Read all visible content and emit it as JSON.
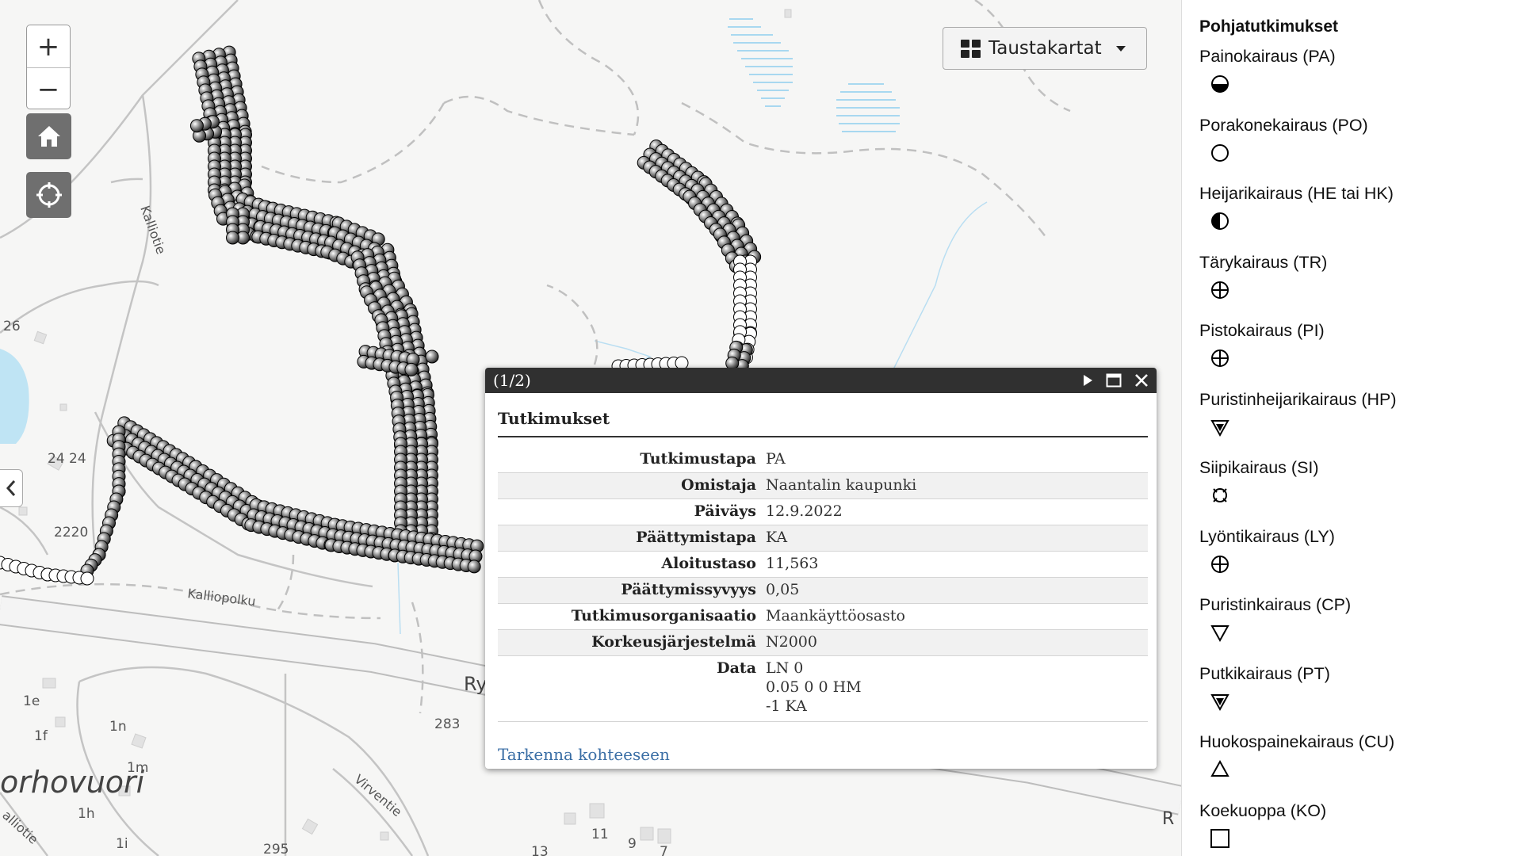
{
  "map": {
    "labels": [
      {
        "id": "kalliotie",
        "text": "Kalliotie"
      },
      {
        "id": "kalliopolku",
        "text": "Kalliopolku"
      },
      {
        "id": "virventie",
        "text": "Virventie"
      },
      {
        "id": "alliotie",
        "text": "alliotie"
      },
      {
        "id": "orhovuori",
        "text": "orhovuori"
      },
      {
        "id": "ry",
        "text": "Ry"
      },
      {
        "id": "r",
        "text": "R"
      },
      {
        "id": "n26",
        "text": "26"
      },
      {
        "id": "n2424",
        "text": "24 24"
      },
      {
        "id": "n2220",
        "text": "2220"
      },
      {
        "id": "n283",
        "text": "283"
      },
      {
        "id": "n295",
        "text": "295"
      },
      {
        "id": "n1e",
        "text": "1e"
      },
      {
        "id": "n1f",
        "text": "1f"
      },
      {
        "id": "n1n",
        "text": "1n"
      },
      {
        "id": "n1m",
        "text": "1m"
      },
      {
        "id": "n1h",
        "text": "1h"
      },
      {
        "id": "n1i",
        "text": "1i"
      },
      {
        "id": "n11",
        "text": "11"
      },
      {
        "id": "n9",
        "text": "9"
      },
      {
        "id": "n7",
        "text": "7"
      },
      {
        "id": "n13",
        "text": "13"
      }
    ]
  },
  "controls": {
    "zoom_in": "+",
    "zoom_out": "−",
    "basemaps_label": "Taustakartat"
  },
  "popup": {
    "counter": "(1/2)",
    "title": "Tutkimukset",
    "rows": [
      {
        "key": "Tutkimustapa",
        "value": "PA"
      },
      {
        "key": "Omistaja",
        "value": "Naantalin kaupunki"
      },
      {
        "key": "Päiväys",
        "value": "12.9.2022"
      },
      {
        "key": "Päättymistapa",
        "value": "KA"
      },
      {
        "key": "Aloitustaso",
        "value": "11,563"
      },
      {
        "key": "Päättymissyvyys",
        "value": "0,05"
      },
      {
        "key": "Tutkimusorganisaatio",
        "value": "Maankäyttöosasto"
      },
      {
        "key": "Korkeusjärjestelmä",
        "value": "N2000"
      },
      {
        "key": "Data",
        "value": "LN 0\n0.05 0 0 HM\n-1 KA"
      }
    ],
    "link": "Tarkenna kohteeseen"
  },
  "legend": {
    "title": "Pohjatutkimukset",
    "items": [
      {
        "label": "Painokairaus (PA)",
        "symbol": "half-filled-circle"
      },
      {
        "label": "Porakonekairaus (PO)",
        "symbol": "open-circle"
      },
      {
        "label": "Heijarikairaus (HE tai HK)",
        "symbol": "quarter-filled-circle"
      },
      {
        "label": "Tärykairaus (TR)",
        "symbol": "crossed-circle"
      },
      {
        "label": "Pistokairaus (PI)",
        "symbol": "crossed-circle"
      },
      {
        "label": "Puristinheijarikairaus (HP)",
        "symbol": "filled-triangle"
      },
      {
        "label": "Siipikairaus (SI)",
        "symbol": "vane-circle"
      },
      {
        "label": "Lyöntikairaus (LY)",
        "symbol": "crossed-circle"
      },
      {
        "label": "Puristinkairaus (CP)",
        "symbol": "open-triangle-down"
      },
      {
        "label": "Putkikairaus (PT)",
        "symbol": "filled-triangle"
      },
      {
        "label": "Huokospainekairaus (CU)",
        "symbol": "open-triangle-up"
      },
      {
        "label": "Koekuoppa (KO)",
        "symbol": "open-square"
      }
    ]
  }
}
